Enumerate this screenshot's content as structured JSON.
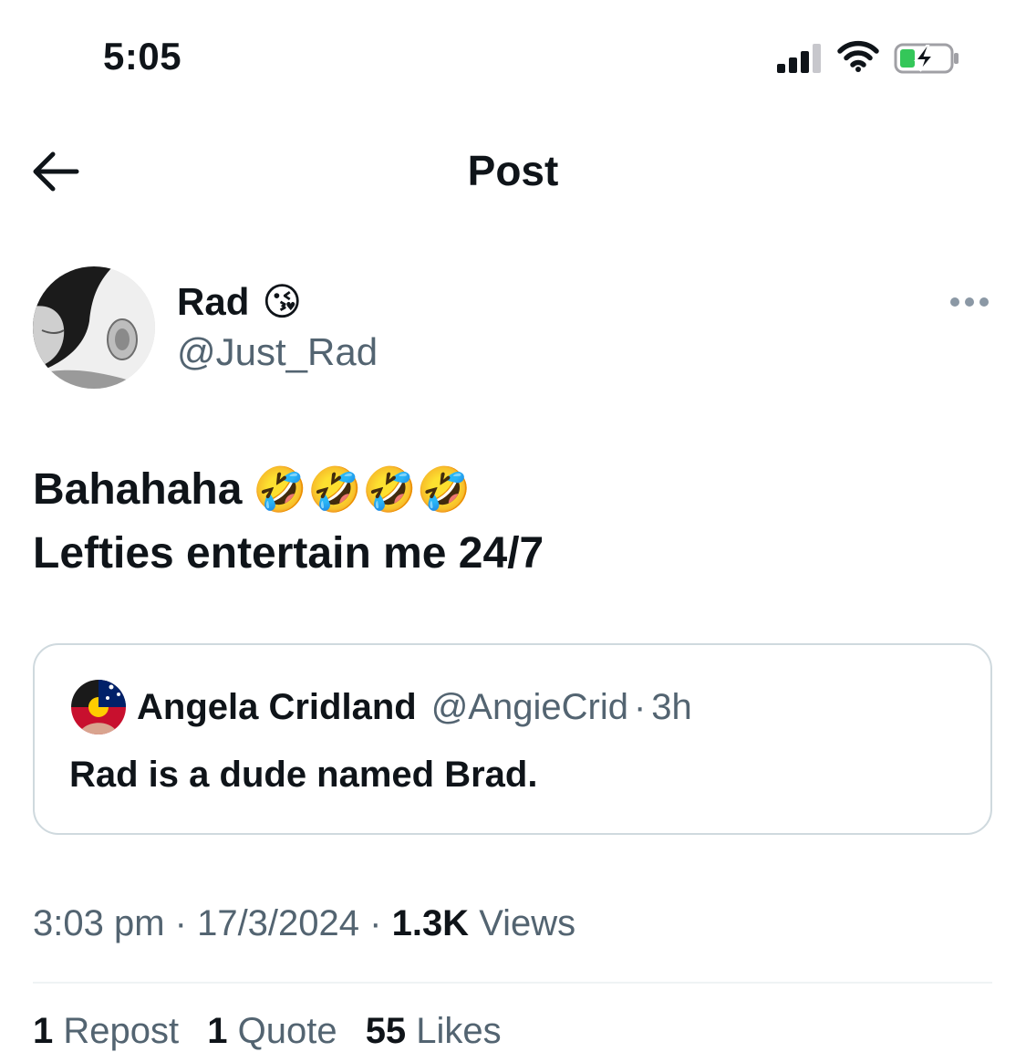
{
  "status_bar": {
    "time": "5:05"
  },
  "header": {
    "title": "Post"
  },
  "author": {
    "name": "Rad",
    "name_emoji": "😘",
    "handle": "@Just_Rad"
  },
  "tweet": {
    "line1": "Bahahaha",
    "line1_emoji": "🤣🤣🤣🤣",
    "line2": "Lefties entertain me 24/7"
  },
  "quote": {
    "name": "Angela Cridland",
    "handle": "@AngieCrid",
    "separator": "·",
    "age": "3h",
    "text": "Rad is a dude named Brad."
  },
  "meta": {
    "time": "3:03 pm",
    "sep1": " · ",
    "date": "17/3/2024",
    "sep2": " · ",
    "views_count": "1.3K",
    "views_label": " Views"
  },
  "stats": {
    "reposts_count": "1",
    "reposts_label": " Repost",
    "quotes_count": "1",
    "quotes_label": " Quote",
    "likes_count": "55",
    "likes_label": " Likes"
  },
  "colors": {
    "text": "#0f1419",
    "secondary": "#536471",
    "border": "#cfd9de",
    "battery_green": "#34c759"
  },
  "icons": [
    "signal-icon",
    "wifi-icon",
    "battery-charging-icon",
    "back-arrow-icon",
    "more-icon"
  ]
}
